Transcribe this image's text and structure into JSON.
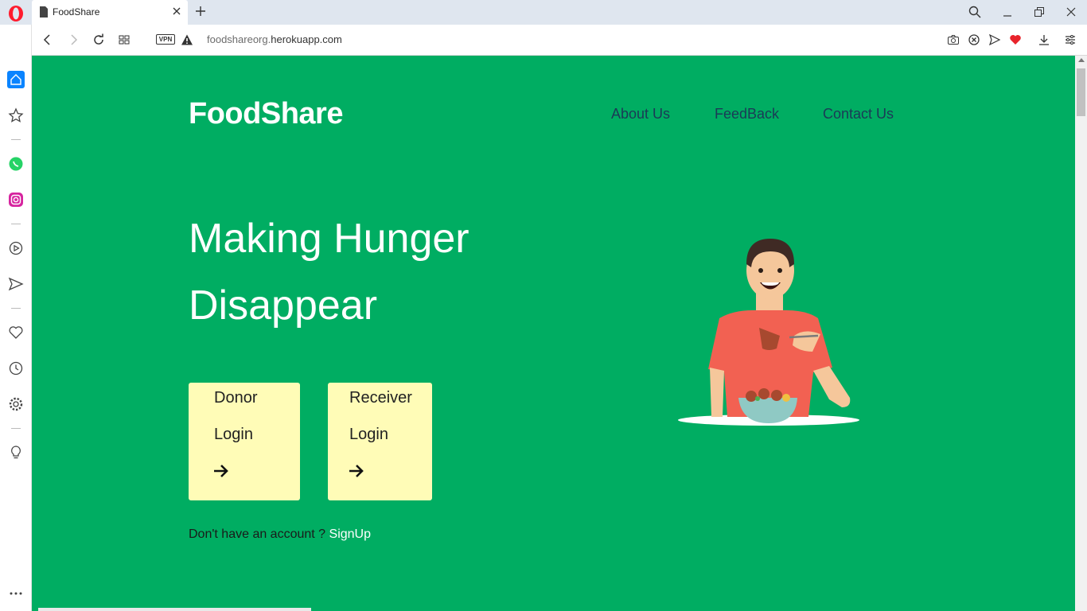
{
  "browser": {
    "tab_title": "FoodShare",
    "url_prefix": "foodshareorg.",
    "url_host": "herokuapp.com",
    "vpn_label": "VPN"
  },
  "site": {
    "brand": "FoodShare",
    "nav": [
      "About Us",
      "FeedBack",
      "Contact Us"
    ],
    "headline_line1": "Making Hunger",
    "headline_line2": "Disappear",
    "donor_card": {
      "line1": "Donor",
      "line2": "Login"
    },
    "receiver_card": {
      "line1": "Receiver",
      "line2": "Login"
    },
    "signup_prompt": "Don't have an account ?",
    "signup_link": "SignUp"
  },
  "colors": {
    "page_bg": "#00ad62",
    "card_bg": "#fffcb7",
    "nav_text": "#1b3a57"
  }
}
